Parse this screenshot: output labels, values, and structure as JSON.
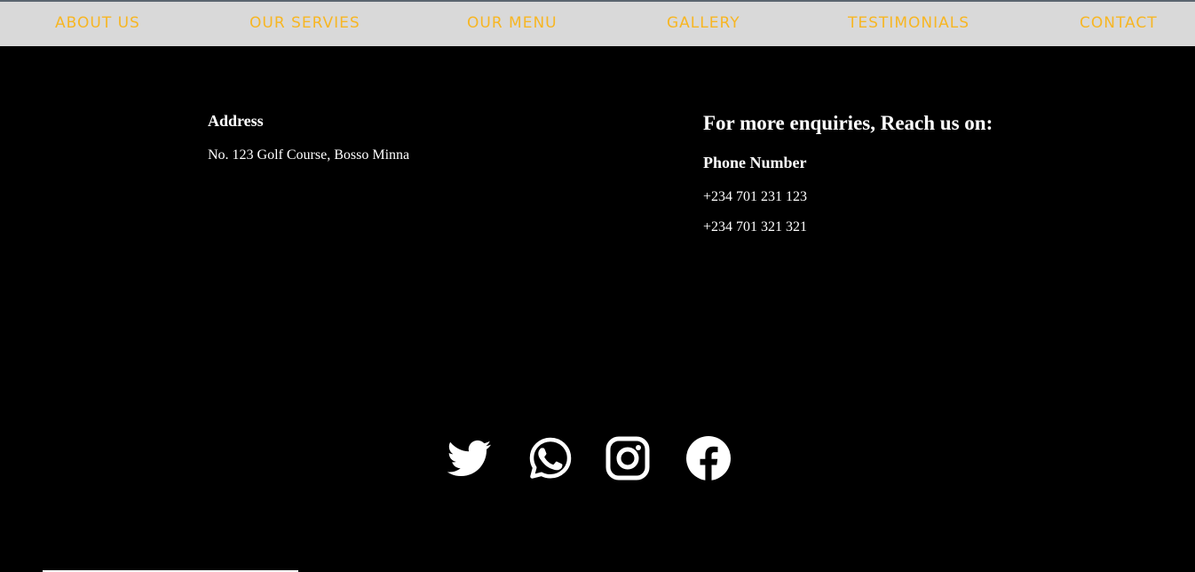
{
  "nav": {
    "items": [
      {
        "label": "ABOUT US"
      },
      {
        "label": "OUR SERVIES"
      },
      {
        "label": "OUR MENU"
      },
      {
        "label": "GALLERY"
      },
      {
        "label": "TESTIMONIALS"
      },
      {
        "label": "CONTACT"
      }
    ]
  },
  "footer": {
    "address": {
      "heading": "Address",
      "text": "No. 123 Golf Course, Bosso Minna"
    },
    "enquiries": {
      "title": "For more enquiries, Reach us on:",
      "phone_heading": "Phone Number",
      "phones": [
        "+234 701 231 123",
        "+234 701 321 321"
      ]
    },
    "social": {
      "icons": [
        "twitter-icon",
        "whatsapp-icon",
        "instagram-icon",
        "facebook-icon"
      ]
    }
  },
  "colors": {
    "nav_background": "#d9d9d9",
    "nav_text": "#f7b623",
    "footer_background": "#000000",
    "footer_text": "#ffffff"
  }
}
